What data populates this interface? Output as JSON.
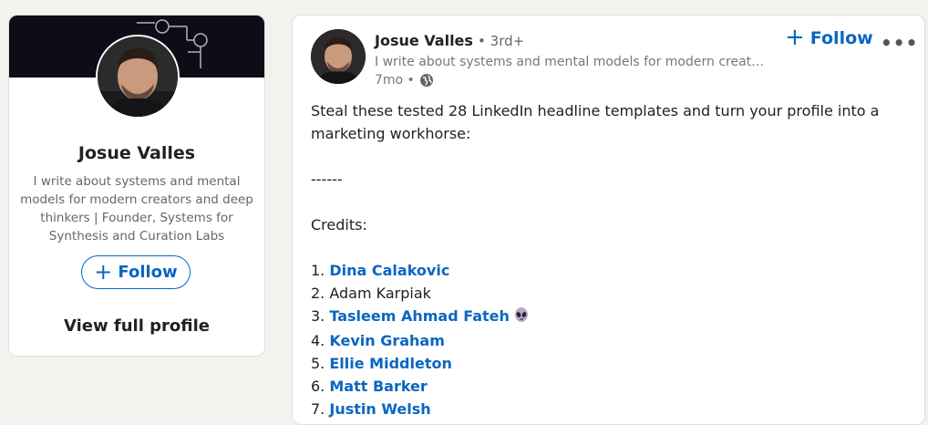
{
  "profile_card": {
    "name": "Josue Valles",
    "bio": "I write about systems and mental models for modern creators and deep thinkers | Founder, Systems for Synthesis and Curation Labs",
    "follow_label": "Follow",
    "view_profile_label": "View full profile"
  },
  "post": {
    "author_name": "Josue Valles",
    "degree": "• 3rd+",
    "headline": "I write about systems and mental models for modern creat…",
    "time": "7mo •",
    "follow_label": "Follow",
    "more_label": "•••",
    "intro_line1": "Steal these tested 28 LinkedIn headline templates and turn your profile into a",
    "intro_line2": "marketing workhorse:",
    "divider": "------",
    "credits_label": "Credits:",
    "credits": [
      {
        "num": "1.",
        "name": "Dina Calakovic"
      },
      {
        "num": "2.",
        "name": "Adam Karpiak"
      },
      {
        "num": "3.",
        "name": "Tasleem Ahmad Fateh"
      },
      {
        "num": "4.",
        "name": "Kevin Graham"
      },
      {
        "num": "5.",
        "name": "Ellie Middleton"
      },
      {
        "num": "6.",
        "name": "Matt Barker"
      },
      {
        "num": "7.",
        "name": "Justin Welsh"
      }
    ]
  },
  "colors": {
    "link": "#0a66c2",
    "background": "#f3f2ef",
    "banner": "#0d0d18"
  }
}
